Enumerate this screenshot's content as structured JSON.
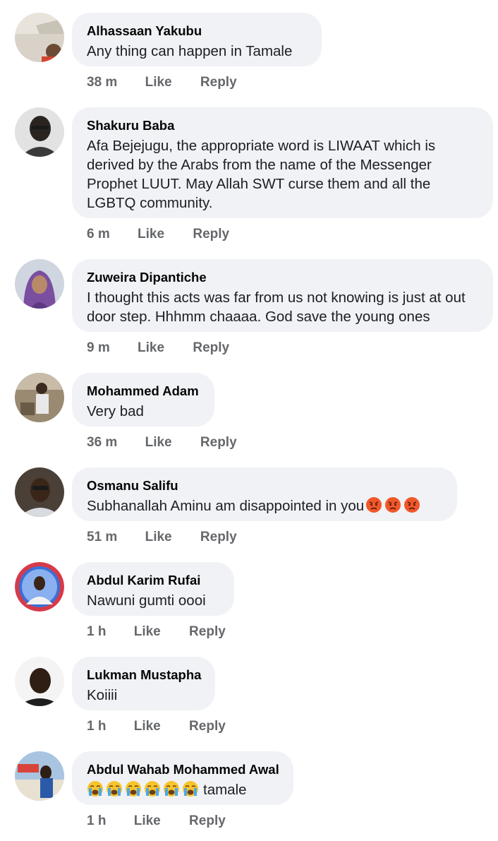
{
  "comments": [
    {
      "author": "Alhassaan Yakubu",
      "text": "Any thing can happen in Tamale",
      "time": "38 m",
      "like_label": "Like",
      "reply_label": "Reply",
      "avatar_icon": "profile-photo"
    },
    {
      "author": "Shakuru Baba",
      "text": "Afa Bejejugu, the appropriate word is LIWAAT which is derived by the Arabs from the name of the Messenger Prophet LUUT. May Allah SWT curse them and all the LGBTQ community.",
      "time": "6 m",
      "like_label": "Like",
      "reply_label": "Reply",
      "avatar_icon": "profile-photo"
    },
    {
      "author": "Zuweira Dipantiche",
      "text": "I thought this acts was far from us not knowing is just at out door step. Hhhmm chaaaa. God save the young ones",
      "time": "9 m",
      "like_label": "Like",
      "reply_label": "Reply",
      "avatar_icon": "profile-photo"
    },
    {
      "author": "Mohammed Adam",
      "text": "Very bad",
      "time": "36 m",
      "like_label": "Like",
      "reply_label": "Reply",
      "avatar_icon": "profile-photo"
    },
    {
      "author": "Osmanu Salifu",
      "text": "Subhanallah Aminu am disappointed in you",
      "emoji": "angry-face",
      "emoji_count": 3,
      "time": "51 m",
      "like_label": "Like",
      "reply_label": "Reply",
      "avatar_icon": "profile-photo"
    },
    {
      "author": "Abdul Karim Rufai",
      "text": "Nawuni gumti oooi",
      "time": "1 h",
      "like_label": "Like",
      "reply_label": "Reply",
      "avatar_icon": "profile-photo"
    },
    {
      "author": "Lukman Mustapha",
      "text": "Koiiii",
      "time": "1 h",
      "like_label": "Like",
      "reply_label": "Reply",
      "avatar_icon": "profile-photo"
    },
    {
      "author": "Abdul Wahab Mohammed Awal",
      "text": "tamale",
      "emoji": "crying-face",
      "emoji_count": 6,
      "time": "1 h",
      "like_label": "Like",
      "reply_label": "Reply",
      "avatar_icon": "profile-photo"
    }
  ],
  "colors": {
    "bubble": "#f0f2f5",
    "meta_text": "#65676b",
    "author_text": "#050505"
  }
}
